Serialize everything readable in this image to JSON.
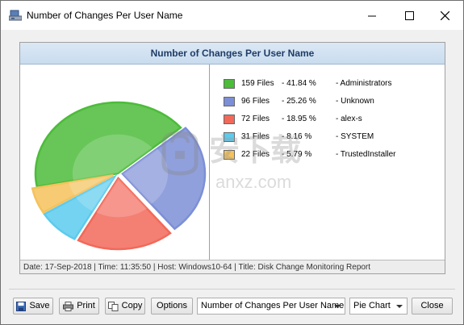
{
  "window": {
    "title": "Number of Changes Per User Name"
  },
  "report": {
    "header": "Number of Changes Per User Name",
    "footer": "Date: 17-Sep-2018 | Time: 11:35:50 | Host: Windows10-64 | Title: Disk Change Monitoring Report"
  },
  "chart_data": {
    "type": "pie",
    "title": "Number of Changes Per User Name",
    "categories": [
      "Administrators",
      "Unknown",
      "alex-s",
      "SYSTEM",
      "TrustedInstaller"
    ],
    "values": [
      159,
      96,
      72,
      31,
      22
    ],
    "percent": [
      41.84,
      25.26,
      18.95,
      8.16,
      5.79
    ],
    "colors": [
      "#4cbc3a",
      "#7c8fd6",
      "#f2695a",
      "#5ccbee",
      "#f5c25b"
    ],
    "legend_position": "right"
  },
  "legend": [
    {
      "files": "159 Files",
      "pct": "-  41.84 %",
      "name": "-  Administrators",
      "color": "#4cbc3a"
    },
    {
      "files": "96 Files",
      "pct": "-  25.26 %",
      "name": "-  Unknown",
      "color": "#7c8fd6"
    },
    {
      "files": "72 Files",
      "pct": "-  18.95 %",
      "name": "-  alex-s",
      "color": "#f2695a"
    },
    {
      "files": "31 Files",
      "pct": "-  8.16 %",
      "name": "-  SYSTEM",
      "color": "#5ccbee"
    },
    {
      "files": "22 Files",
      "pct": "-  5.79 %",
      "name": "-  TrustedInstaller",
      "color": "#f5c25b"
    }
  ],
  "toolbar": {
    "save_label": "Save",
    "print_label": "Print",
    "copy_label": "Copy",
    "options_label": "Options",
    "report_select": "Number of Changes Per User Name",
    "chart_type_select": "Pie Chart",
    "close_label": "Close"
  },
  "watermark": {
    "text": "安下载",
    "sub": "anxz.com"
  },
  "icons": {
    "app": "disk-monitor-icon",
    "minimize": "minimize-icon",
    "maximize": "maximize-icon",
    "close": "close-icon",
    "save": "floppy-disk-icon",
    "print": "printer-icon",
    "copy": "copy-icon"
  }
}
